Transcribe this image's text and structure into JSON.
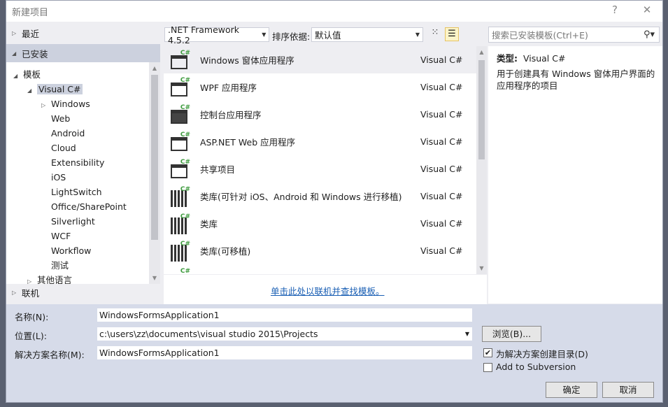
{
  "dialog": {
    "title": "新建项目",
    "help": "?",
    "close": "✕"
  },
  "left": {
    "recent": "最近",
    "installed": "已安装",
    "online": "联机",
    "tree": {
      "templates": "模板",
      "visual_csharp": "Visual C#",
      "windows": "Windows",
      "children": [
        "Web",
        "Android",
        "Cloud",
        "Extensibility",
        "iOS",
        "LightSwitch",
        "Office/SharePoint",
        "Silverlight",
        "WCF",
        "Workflow",
        "测试"
      ],
      "cut_item": "其他语言"
    }
  },
  "toolbar": {
    "framework": ".NET Framework 4.5.2",
    "sort_label": "排序依据:",
    "sort_value": "默认值"
  },
  "search": {
    "placeholder": "搜索已安装模板(Ctrl+E)"
  },
  "templates": [
    {
      "name": "Windows 窗体应用程序",
      "lang": "Visual C#",
      "icon": "winforms-icon",
      "selected": true
    },
    {
      "name": "WPF 应用程序",
      "lang": "Visual C#",
      "icon": "wpf-icon"
    },
    {
      "name": "控制台应用程序",
      "lang": "Visual C#",
      "icon": "console-icon"
    },
    {
      "name": "ASP.NET Web 应用程序",
      "lang": "Visual C#",
      "icon": "web-icon"
    },
    {
      "name": "共享项目",
      "lang": "Visual C#",
      "icon": "shared-icon"
    },
    {
      "name": "类库(可针对 iOS、Android 和 Windows 进行移植)",
      "lang": "Visual C#",
      "icon": "library-icon"
    },
    {
      "name": "类库",
      "lang": "Visual C#",
      "icon": "library-icon"
    },
    {
      "name": "类库(可移植)",
      "lang": "Visual C#",
      "icon": "library-icon"
    }
  ],
  "online_link": "单击此处以联机并查找模板。",
  "details": {
    "type_label": "类型:",
    "type_value": "Visual C#",
    "description": "用于创建具有 Windows 窗体用户界面的应用程序的项目"
  },
  "form": {
    "name_label": "名称(N):",
    "name_value": "WindowsFormsApplication1",
    "location_label": "位置(L):",
    "location_value": "c:\\users\\zz\\documents\\visual studio 2015\\Projects",
    "solution_label": "解决方案名称(M):",
    "solution_value": "WindowsFormsApplication1",
    "browse": "浏览(B)...",
    "create_dir": "为解决方案创建目录(D)",
    "create_dir_checked": true,
    "subversion": "Add to Subversion",
    "subversion_checked": false,
    "ok": "确定",
    "cancel": "取消"
  },
  "colors": {
    "accent_csharp": "#3c9a3c",
    "link": "#1a5fb4",
    "selected_row": "#ccd1de",
    "bottom_bg": "#d6dbe9"
  }
}
